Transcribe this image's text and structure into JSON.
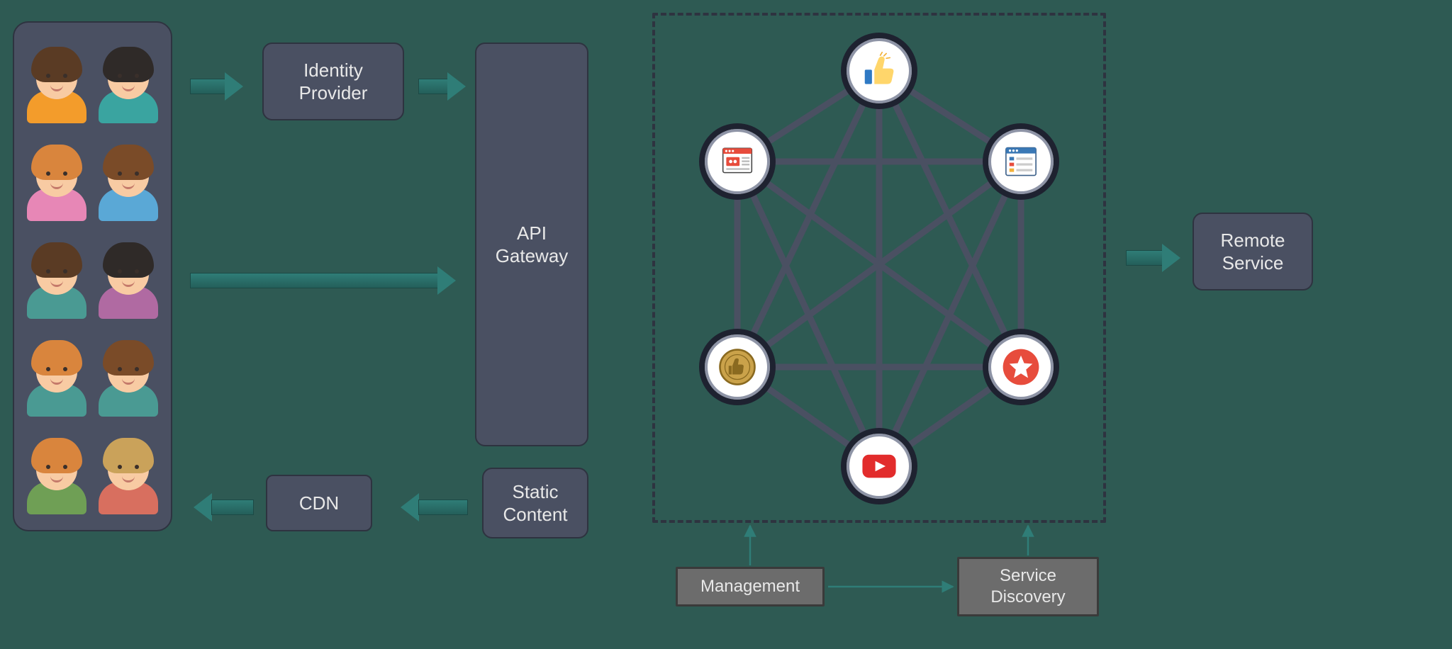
{
  "labels": {
    "identity_provider": "Identity Provider",
    "api_gateway": "API Gateway",
    "cdn": "CDN",
    "static_content": "Static Content",
    "remote_service": "Remote Service",
    "management": "Management",
    "service_discovery": "Service Discovery"
  },
  "services": [
    {
      "id": "like",
      "name": "thumbs-up-icon"
    },
    {
      "id": "news",
      "name": "news-window-icon"
    },
    {
      "id": "browser",
      "name": "browser-list-icon"
    },
    {
      "id": "popular",
      "name": "popular-badge-icon"
    },
    {
      "id": "star",
      "name": "star-badge-icon"
    },
    {
      "id": "video",
      "name": "video-play-icon"
    }
  ],
  "users": [
    {
      "hair": "#5a3b24",
      "shirt": "#f39c2b"
    },
    {
      "hair": "#2f2a28",
      "shirt": "#3aa4a0"
    },
    {
      "hair": "#d9853d",
      "shirt": "#e787b6"
    },
    {
      "hair": "#7a4b28",
      "shirt": "#5aa8d6"
    },
    {
      "hair": "#5a3b24",
      "shirt": "#4a9a93"
    },
    {
      "hair": "#2f2a28",
      "shirt": "#b06aa2"
    },
    {
      "hair": "#d9853d",
      "shirt": "#4a9a93"
    },
    {
      "hair": "#7a4b28",
      "shirt": "#4a9a93"
    },
    {
      "hair": "#d9853d",
      "shirt": "#6f9f55"
    },
    {
      "hair": "#caa25a",
      "shirt": "#d86f5f"
    }
  ]
}
